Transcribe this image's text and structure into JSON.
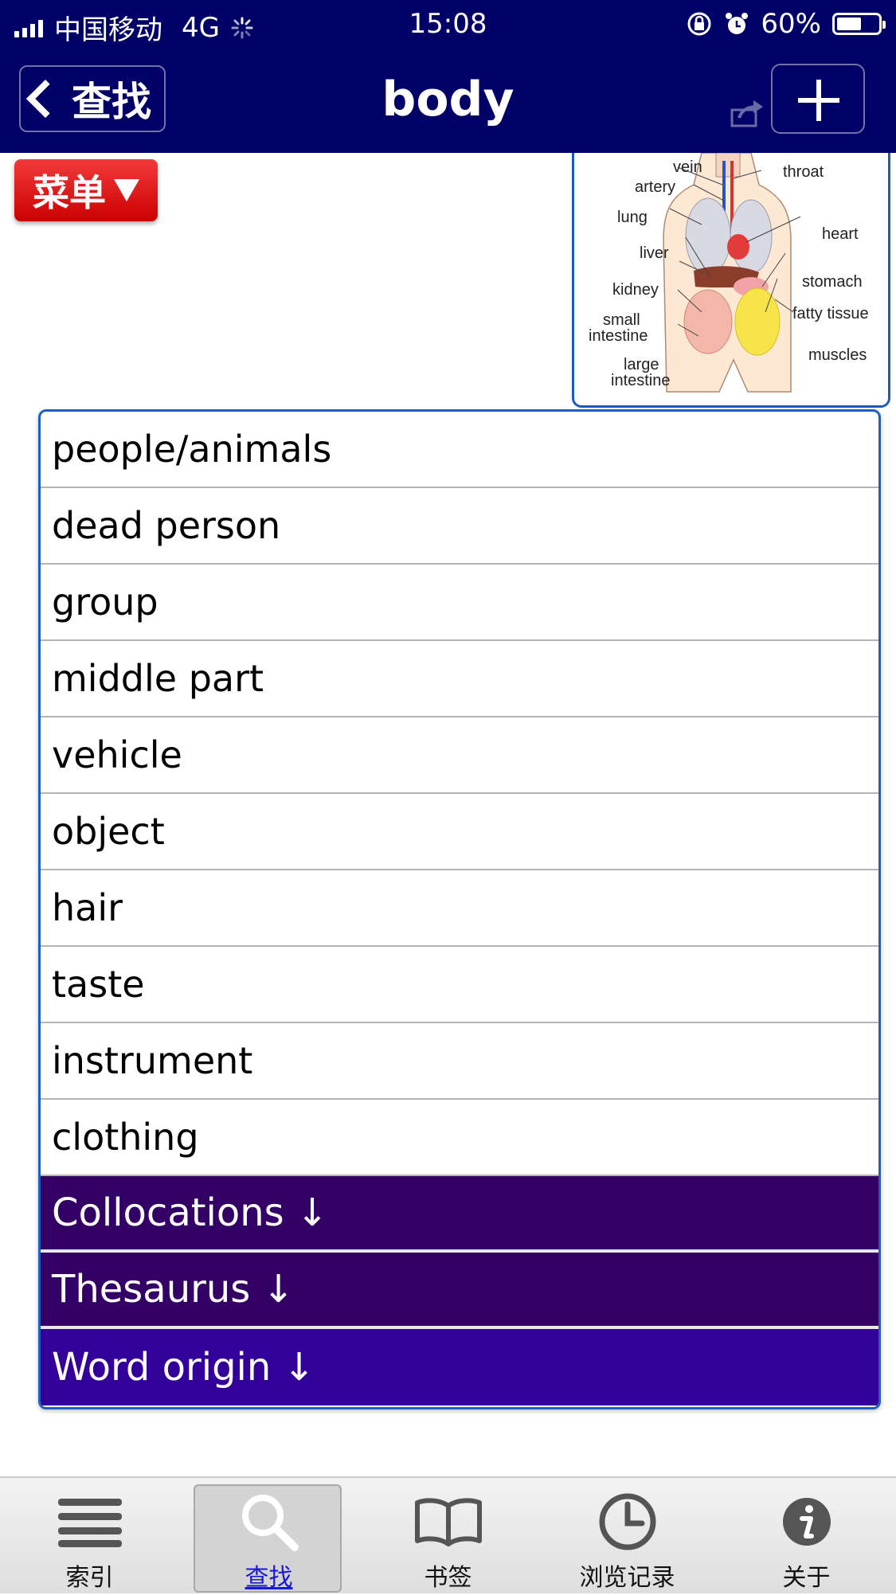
{
  "status_bar": {
    "carrier": "中国移动",
    "network": "4G",
    "time": "15:08",
    "battery_percent": "60%",
    "battery_level": 0.6
  },
  "nav": {
    "back_label": "查找",
    "title": "body"
  },
  "menu_button": {
    "label": "菜单"
  },
  "illustration": {
    "labels": {
      "vein": "vein",
      "throat": "throat",
      "artery": "artery",
      "lung": "lung",
      "heart": "heart",
      "liver": "liver",
      "stomach": "stomach",
      "kidney": "kidney",
      "fatty_tissue": "fatty tissue",
      "small": "small",
      "intestine_small": "intestine",
      "muscles": "muscles",
      "large": "large",
      "intestine_large": "intestine"
    }
  },
  "senses": [
    "people/animals",
    "dead person",
    "group",
    "middle part",
    "vehicle",
    "object",
    "hair",
    "taste",
    "instrument",
    "clothing"
  ],
  "sections": [
    "Collocations ↓",
    "Thesaurus ↓",
    "Word origin ↓"
  ],
  "tabs": [
    {
      "label": "索引",
      "icon": "list-icon"
    },
    {
      "label": "查找",
      "icon": "search-icon"
    },
    {
      "label": "书签",
      "icon": "book-icon"
    },
    {
      "label": "浏览记录",
      "icon": "clock-icon"
    },
    {
      "label": "关于",
      "icon": "info-icon"
    }
  ]
}
